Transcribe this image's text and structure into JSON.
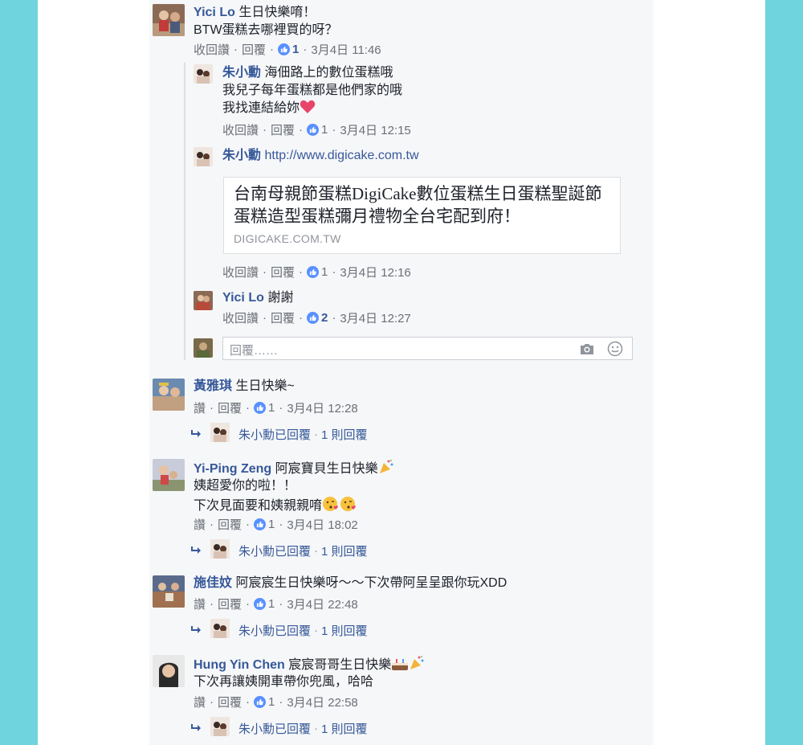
{
  "comments": [
    {
      "author": "Yici Lo",
      "lines": [
        "生日快樂唷！",
        "BTW蛋糕去哪裡買的呀？"
      ],
      "actions": [
        "收回讚",
        "回覆"
      ],
      "likes": "1",
      "time": "3月4日 11:46",
      "replies": [
        {
          "author": "朱小勳",
          "lines": [
            "海佃路上的數位蛋糕哦",
            "我兒子每年蛋糕都是他們家的哦",
            "我找連結給妳"
          ],
          "actions": [
            "收回讚",
            "回覆"
          ],
          "likes": "1",
          "time": "3月4日 12:15"
        },
        {
          "author": "朱小勳",
          "link_text": "http://www.digicake.com.tw",
          "card": {
            "title": "台南母親節蛋糕DigiCake數位蛋糕生日蛋糕聖誕節蛋糕造型蛋糕彌月禮物全台宅配到府！",
            "domain": "DIGICAKE.COM.TW"
          },
          "actions": [
            "收回讚",
            "回覆"
          ],
          "likes": "1",
          "time": "3月4日 12:16"
        },
        {
          "author": "Yici Lo",
          "lines": [
            "謝謝"
          ],
          "actions": [
            "收回讚",
            "回覆"
          ],
          "likes": "2",
          "time": "3月4日 12:27"
        }
      ],
      "reply_placeholder": "回覆……"
    },
    {
      "author": "黃雅琪",
      "lines": [
        "生日快樂~"
      ],
      "actions": [
        "讚",
        "回覆"
      ],
      "likes": "1",
      "time": "3月4日 12:28",
      "replied_by": "朱小勳已回覆",
      "reply_count": "1 則回覆"
    },
    {
      "author": "Yi-Ping Zeng",
      "lines": [
        "阿宸寶貝生日快樂",
        "姨超愛你的啦！！",
        "下次見面要和姨親親唷"
      ],
      "actions": [
        "讚",
        "回覆"
      ],
      "likes": "1",
      "time": "3月4日 18:02",
      "replied_by": "朱小勳已回覆",
      "reply_count": "1 則回覆"
    },
    {
      "author": "施佳妏",
      "lines": [
        "阿宸宸生日快樂呀～～下次帶阿呈呈跟你玩XDD"
      ],
      "actions": [
        "讚",
        "回覆"
      ],
      "likes": "1",
      "time": "3月4日 22:48",
      "replied_by": "朱小勳已回覆",
      "reply_count": "1 則回覆"
    },
    {
      "author": "Hung Yin Chen",
      "lines": [
        "宸宸哥哥生日快樂",
        "下次再讓姨開車帶你兜風，哈哈"
      ],
      "actions": [
        "讚",
        "回覆"
      ],
      "likes": "1",
      "time": "3月4日 22:58",
      "replied_by": "朱小勳已回覆",
      "reply_count": "1 則回覆"
    }
  ],
  "colors": {
    "background": "#6fd4de",
    "name": "#365899",
    "meta": "#6b6f76",
    "like": "#5890ff"
  }
}
